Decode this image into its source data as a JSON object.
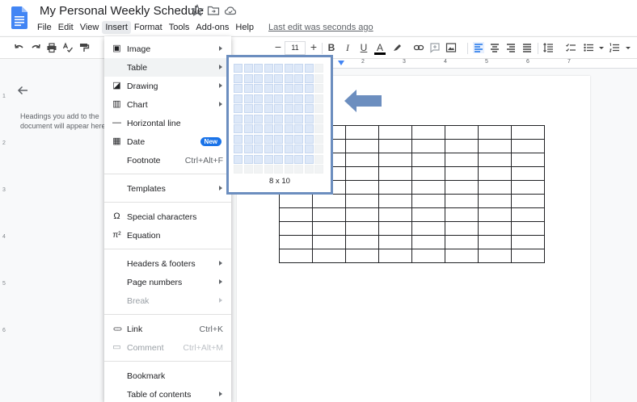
{
  "header": {
    "title": "My Personal Weekly Schedule",
    "menus": [
      "File",
      "Edit",
      "View",
      "Insert",
      "Format",
      "Tools",
      "Add-ons",
      "Help"
    ],
    "active_menu": "Insert",
    "last_edit": "Last edit was seconds ago"
  },
  "toolbar": {
    "font_size": "11",
    "minus": "−",
    "plus": "+",
    "bold": "B",
    "italic": "I",
    "underline": "U",
    "text_color": "A"
  },
  "sidebar": {
    "hint": "Headings you add to the document will appear here."
  },
  "ruler": {
    "numbers": [
      "2",
      "3",
      "4",
      "5",
      "6",
      "7"
    ],
    "vnumbers": [
      "1",
      "2",
      "3",
      "4",
      "5",
      "6"
    ]
  },
  "insert_menu": {
    "items": [
      {
        "label": "Image",
        "icon": "image-icon",
        "glyph": "▣",
        "arrow": true
      },
      {
        "label": "Table",
        "icon": "",
        "glyph": "",
        "arrow": true,
        "highlighted": true
      },
      {
        "label": "Drawing",
        "icon": "drawing-icon",
        "glyph": "◪",
        "arrow": true
      },
      {
        "label": "Chart",
        "icon": "chart-icon",
        "glyph": "▥",
        "arrow": true
      },
      {
        "label": "Horizontal line",
        "icon": "horizontal-line-icon",
        "glyph": "—"
      },
      {
        "label": "Date",
        "icon": "calendar-icon",
        "glyph": "▦",
        "badge": "New"
      },
      {
        "label": "Footnote",
        "icon": "",
        "glyph": "",
        "shortcut": "Ctrl+Alt+F"
      },
      {
        "sep": true
      },
      {
        "label": "Templates",
        "icon": "",
        "glyph": "",
        "arrow": true
      },
      {
        "sep": true
      },
      {
        "label": "Special characters",
        "icon": "omega-icon",
        "glyph": "Ω"
      },
      {
        "label": "Equation",
        "icon": "pi-icon",
        "glyph": "π²"
      },
      {
        "sep": true
      },
      {
        "label": "Headers & footers",
        "icon": "",
        "glyph": "",
        "arrow": true
      },
      {
        "label": "Page numbers",
        "icon": "",
        "glyph": "",
        "arrow": true
      },
      {
        "label": "Break",
        "icon": "",
        "glyph": "",
        "arrow": true,
        "disabled": true
      },
      {
        "sep": true
      },
      {
        "label": "Link",
        "icon": "link-icon",
        "glyph": "⊂⊃",
        "shortcut": "Ctrl+K"
      },
      {
        "label": "Comment",
        "icon": "comment-icon",
        "glyph": "▭",
        "shortcut": "Ctrl+Alt+M",
        "disabled": true
      },
      {
        "sep": true
      },
      {
        "label": "Bookmark",
        "icon": "",
        "glyph": ""
      },
      {
        "label": "Table of contents",
        "icon": "",
        "glyph": "",
        "arrow": true
      }
    ]
  },
  "table_picker": {
    "size_label": "8 x 10",
    "selected_cols": 8,
    "selected_rows": 10,
    "grid_cols": 9,
    "grid_rows": 11
  },
  "document_table": {
    "rows": 10,
    "cols": 8
  },
  "colors": {
    "accent": "#1a73e8",
    "picker_border": "#6c8ebf",
    "arrow": "#6c8ebf"
  }
}
